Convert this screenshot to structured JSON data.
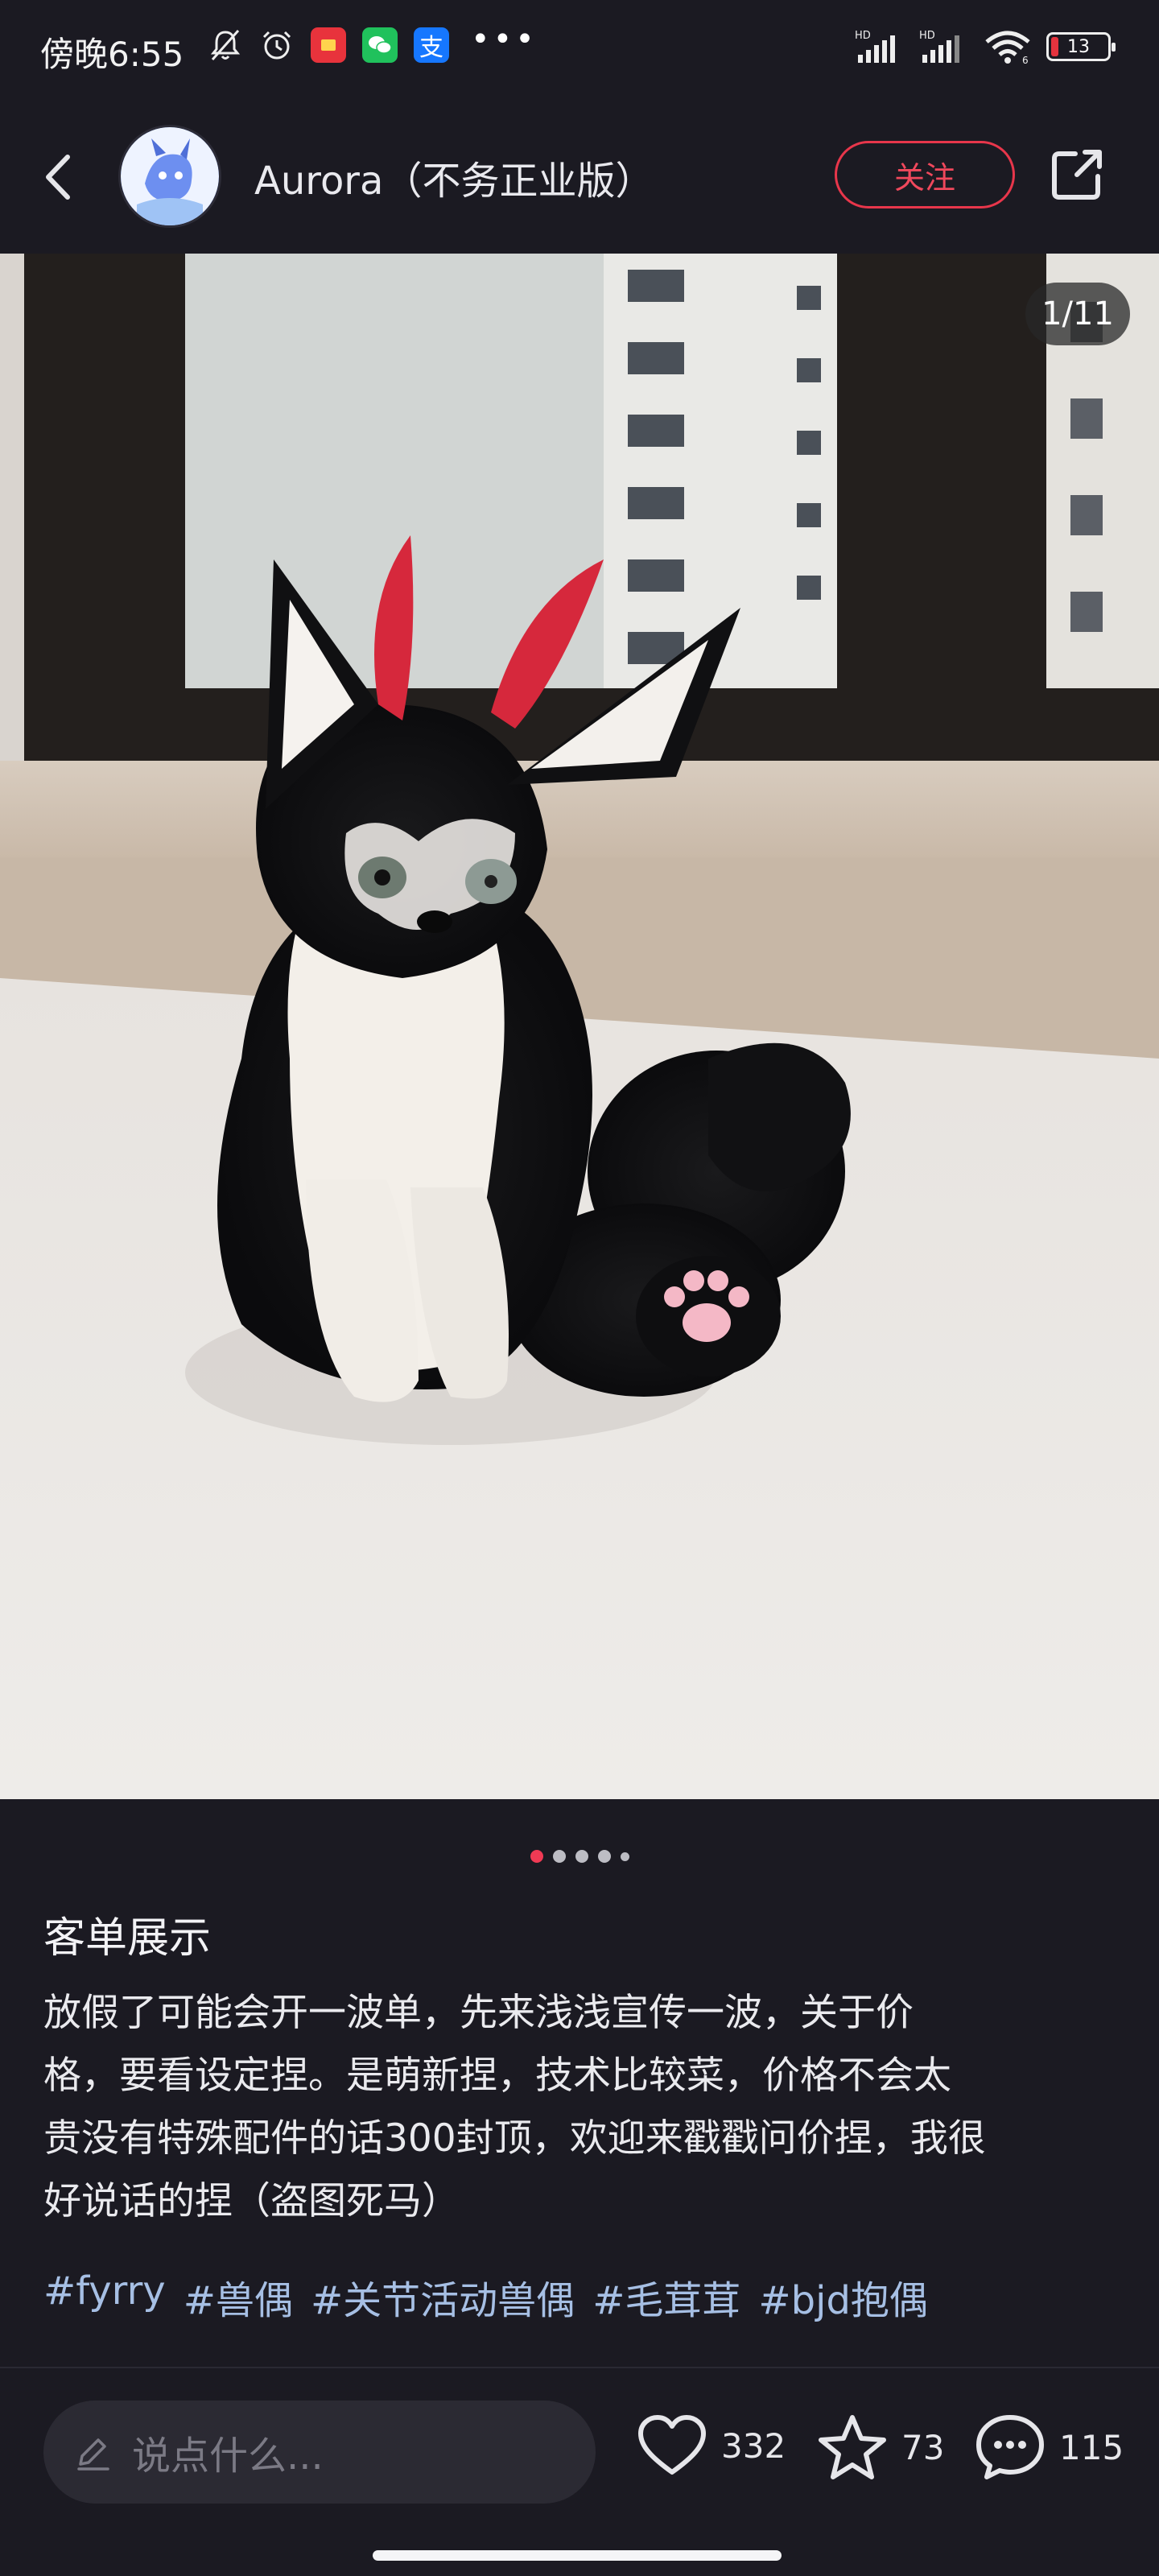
{
  "status_bar": {
    "time": "傍晚6:55",
    "hd1": "HD",
    "hd2": "HD",
    "wifi_badge": "6",
    "battery": "13"
  },
  "header": {
    "author": "Aurora（不务正业版）",
    "follow_label": "关注"
  },
  "photo": {
    "page_counter": "1/11"
  },
  "post": {
    "title": "客单展示",
    "body_lines": [
      "放假了可能会开一波单，先来浅浅宣传一波，关于价",
      "格，要看设定捏。是萌新捏，技术比较菜，价格不会太",
      "贵没有特殊配件的话300封顶，欢迎来戳戳问价捏，我很",
      "好说话的捏（盗图死马）"
    ],
    "tags": [
      "#fyrry",
      "#兽偶",
      "#关节活动兽偶",
      "#毛茸茸",
      "#bjd抱偶"
    ]
  },
  "bottom": {
    "comment_placeholder": "说点什么...",
    "likes": "332",
    "favorites": "73",
    "comments": "115"
  },
  "colors": {
    "background": "#1b1a22",
    "accent": "#e8364b",
    "tag": "#a6bfe4"
  }
}
